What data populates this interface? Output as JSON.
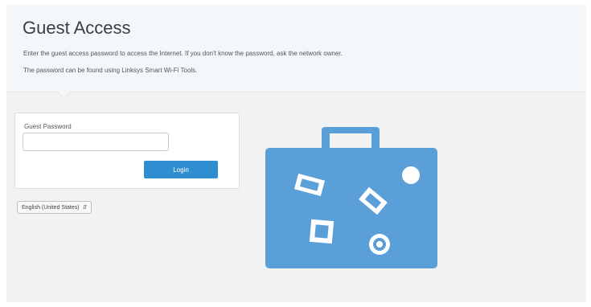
{
  "header": {
    "title": "Guest Access",
    "description_line1": "Enter the guest access password to access the Internet. If you don't know the password, ask the network owner.",
    "description_line2": "The password can be found using Linksys Smart Wi-Fi Tools."
  },
  "login": {
    "password_label": "Guest Password",
    "password_value": "",
    "button_label": "Login"
  },
  "language": {
    "selected": "English (United States)"
  },
  "icons": {
    "illustration": "travel-briefcase-icon"
  },
  "colors": {
    "accent": "#2f8ecf",
    "illustration": "#5b9fd9"
  }
}
